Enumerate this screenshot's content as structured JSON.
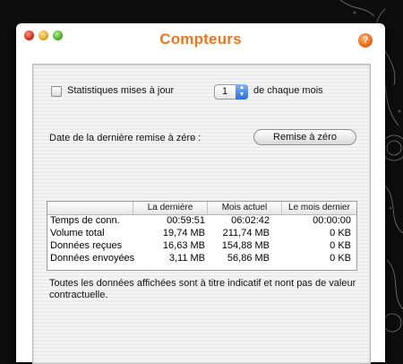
{
  "window": {
    "title": "Compteurs",
    "help_label": "?"
  },
  "settings": {
    "auto_update_label": "Statistiques mises à jour",
    "auto_update_checked": false,
    "day_value": "1",
    "day_suffix": "de chaque mois",
    "last_reset_label": "Date de la dernière remise à zéro :",
    "last_reset_value": "-",
    "reset_button": "Remise à zéro"
  },
  "table": {
    "headers": [
      "La dernière",
      "Mois actuel",
      "Le mois dernier"
    ],
    "rows": [
      {
        "label": "Temps de conn.",
        "values": [
          "00:59:51",
          "06:02:42",
          "00:00:00"
        ]
      },
      {
        "label": "Volume total",
        "values": [
          "19,74 MB",
          "211,74 MB",
          "0 KB"
        ]
      },
      {
        "label": "Données reçues",
        "values": [
          "16,63 MB",
          "154,88 MB",
          "0 KB"
        ]
      },
      {
        "label": "Données envoyées",
        "values": [
          "3,11 MB",
          "56,86 MB",
          "0 KB"
        ]
      }
    ]
  },
  "footer": {
    "disclaimer_line1": "Toutes les données affichées sont à titre indicatif et nont pas de valeur",
    "disclaimer_line2": "contractuelle."
  },
  "colors": {
    "title": "#f0751d",
    "background": "#0d0d0d"
  }
}
